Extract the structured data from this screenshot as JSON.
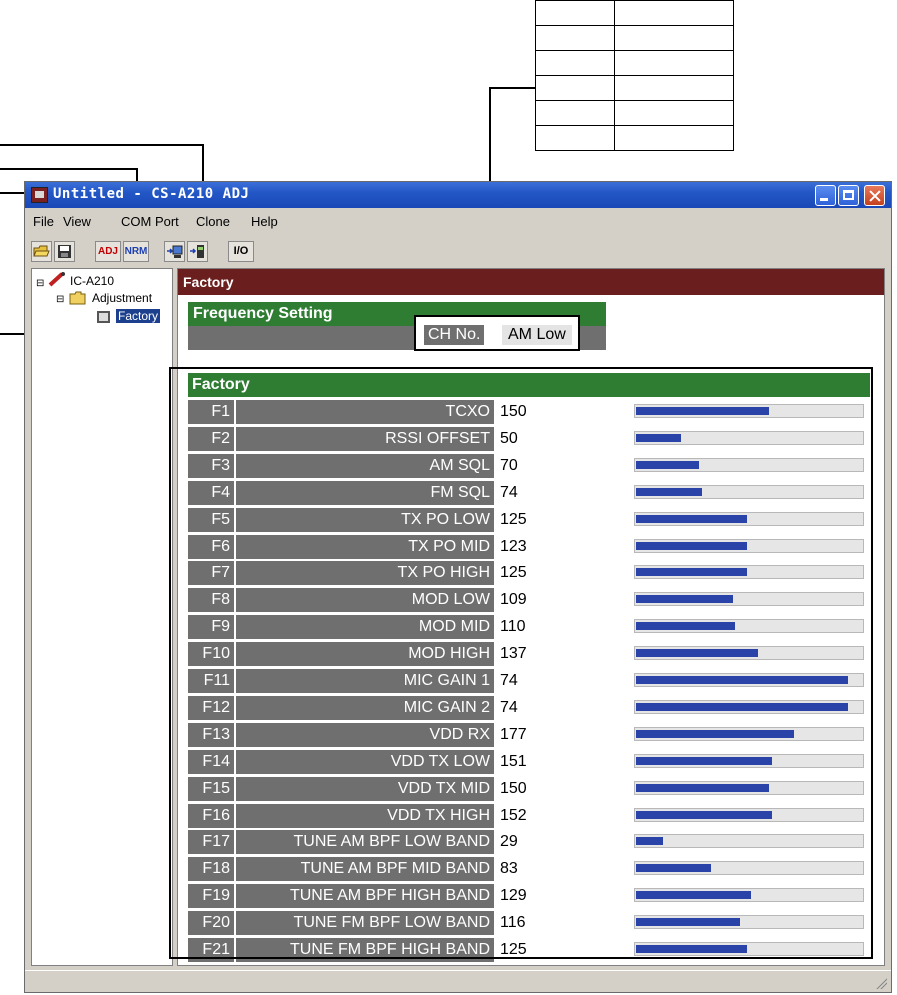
{
  "window": {
    "title": "Untitled - CS-A210 ADJ"
  },
  "menu": [
    {
      "label": "File"
    },
    {
      "label": "View"
    },
    {
      "label": "COM Port"
    },
    {
      "label": "Clone"
    },
    {
      "label": "Help"
    }
  ],
  "toolbar": {
    "adj_label": "ADJ",
    "nrm_label": "NRM",
    "io_label": "I/O"
  },
  "tree": {
    "root": "IC-A210",
    "folder": "Adjustment",
    "leaf": "Factory"
  },
  "main": {
    "header": "Factory",
    "freq_title": "Frequency Setting",
    "ch_label": "CH No.",
    "ch_value": "AM Low"
  },
  "factory": {
    "title": "Factory",
    "max_value": 255,
    "rows": [
      {
        "id": "F1",
        "name": "TCXO",
        "value": 150
      },
      {
        "id": "F2",
        "name": "RSSI OFFSET",
        "value": 50
      },
      {
        "id": "F3",
        "name": "AM SQL",
        "value": 70
      },
      {
        "id": "F4",
        "name": "FM SQL",
        "value": 74
      },
      {
        "id": "F5",
        "name": "TX PO LOW",
        "value": 125
      },
      {
        "id": "F6",
        "name": "TX PO MID",
        "value": 123
      },
      {
        "id": "F7",
        "name": "TX PO HIGH",
        "value": 125
      },
      {
        "id": "F8",
        "name": "MOD LOW",
        "value": 109
      },
      {
        "id": "F9",
        "name": "MOD MID",
        "value": 110
      },
      {
        "id": "F10",
        "name": "MOD HIGH",
        "value": 137
      },
      {
        "id": "F11",
        "name": "MIC GAIN 1",
        "value": 74
      },
      {
        "id": "F12",
        "name": "MIC GAIN 2",
        "value": 74
      },
      {
        "id": "F13",
        "name": "VDD RX",
        "value": 177
      },
      {
        "id": "F14",
        "name": "VDD TX LOW",
        "value": 151
      },
      {
        "id": "F15",
        "name": "VDD TX MID",
        "value": 150
      },
      {
        "id": "F16",
        "name": "VDD TX HIGH",
        "value": 152
      },
      {
        "id": "F17",
        "name": "TUNE AM BPF LOW BAND",
        "value": 29
      },
      {
        "id": "F18",
        "name": "TUNE AM BPF MID BAND",
        "value": 83
      },
      {
        "id": "F19",
        "name": "TUNE AM BPF HIGH BAND",
        "value": 129
      },
      {
        "id": "F20",
        "name": "TUNE FM BPF LOW BAND",
        "value": 116
      },
      {
        "id": "F21",
        "name": "TUNE FM BPF HIGH BAND",
        "value": 125
      }
    ],
    "bar_fill": [
      0.59,
      0.2,
      0.28,
      0.29,
      0.49,
      0.49,
      0.49,
      0.43,
      0.44,
      0.54,
      0.94,
      0.94,
      0.7,
      0.6,
      0.59,
      0.6,
      0.12,
      0.33,
      0.51,
      0.46,
      0.49
    ]
  },
  "colors": {
    "title_bar": "#2457c6",
    "header_maroon": "#6b1e1e",
    "section_green": "#2e7d32",
    "label_gray": "#6f6f6f",
    "bar_blue": "#2a43a8"
  }
}
